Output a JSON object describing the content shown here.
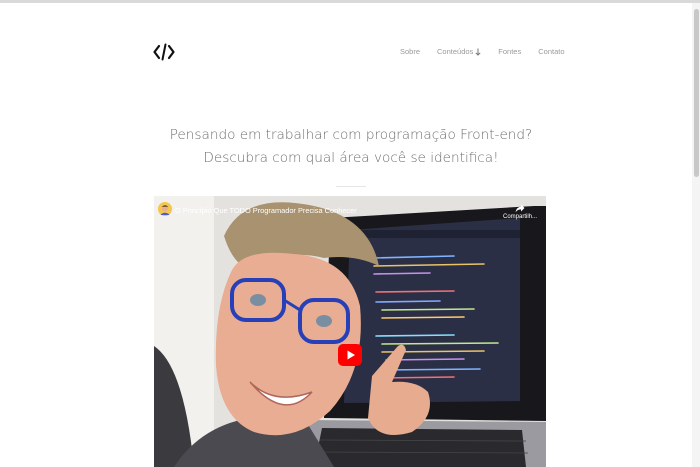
{
  "header": {
    "logo_icon": "code-brackets-icon",
    "nav": [
      {
        "label": "Sobre"
      },
      {
        "label": "Conteúdos",
        "icon": "arrow-down-icon"
      },
      {
        "label": "Fontes"
      },
      {
        "label": "Contato"
      }
    ]
  },
  "main": {
    "headline": "Pensando em trabalhar com programação Front-end? Descubra com qual área você se identifica!"
  },
  "video": {
    "title": "O Princípio Que TODO Programador Precisa Conhecer",
    "share_label": "Compartilh...",
    "play_icon": "youtube-play-icon",
    "share_icon": "share-arrow-icon",
    "channel_icon": "channel-avatar-icon"
  },
  "colors": {
    "youtube_red": "#ff0000",
    "nav_text": "#9a9a9a",
    "headline_text": "#6e6e6e"
  }
}
